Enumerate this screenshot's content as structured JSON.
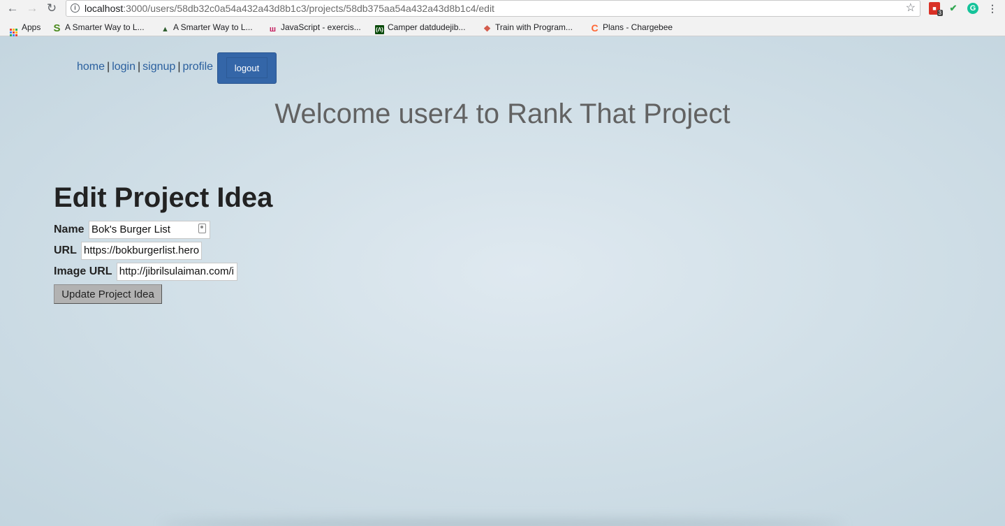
{
  "browser": {
    "url_host": "localhost",
    "url_path": ":3000/users/58db32c0a54a432a43d8b1c3/projects/58db375aa54a432a43d8b1c4/edit",
    "extension_badge": "3"
  },
  "bookmarks": [
    {
      "label": "Apps"
    },
    {
      "label": "A Smarter Way to L..."
    },
    {
      "label": "A Smarter Way to L..."
    },
    {
      "label": "JavaScript - exercis..."
    },
    {
      "label": "Camper datdudejib..."
    },
    {
      "label": "Train with Program..."
    },
    {
      "label": "Plans - Chargebee"
    }
  ],
  "nav": {
    "home": "home",
    "login": "login",
    "signup": "signup",
    "profile": "profile",
    "sep": "|",
    "logout": "logout"
  },
  "welcome": "Welcome user4 to Rank That Project",
  "form": {
    "title": "Edit Project Idea",
    "name_label": "Name",
    "name_value": "Bok's Burger List",
    "url_label": "URL",
    "url_value": "https://bokburgerlist.herokuapp.com",
    "image_label": "Image URL",
    "image_value": "http://jibrilsulaiman.com/images/burger.png",
    "submit": "Update Project Idea"
  }
}
